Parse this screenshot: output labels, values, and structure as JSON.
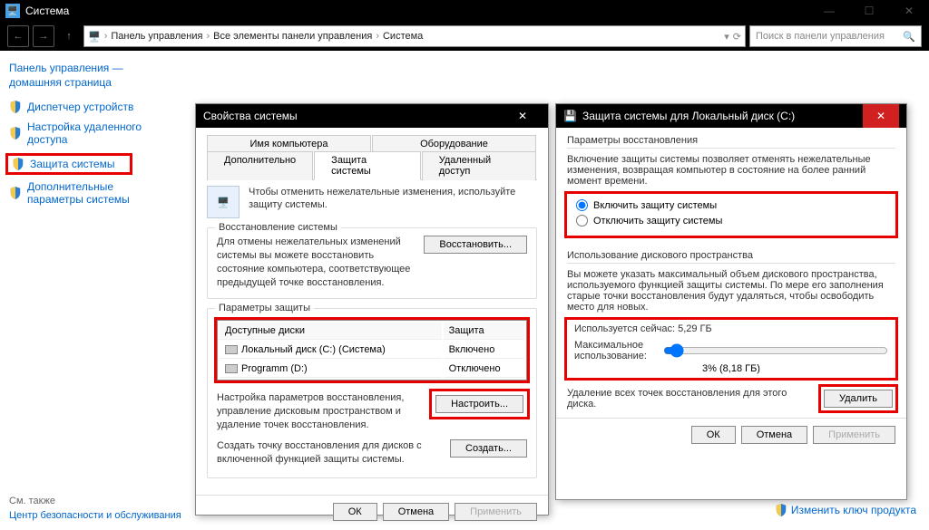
{
  "titlebar": {
    "title": "Система"
  },
  "nav": {
    "breadcrumb": [
      "Панель управления",
      "Все элементы панели управления",
      "Система"
    ],
    "search_placeholder": "Поиск в панели управления"
  },
  "sidebar": {
    "home": "Панель управления — домашняя страница",
    "items": [
      "Диспетчер устройств",
      "Настройка удаленного доступа",
      "Защита системы",
      "Дополнительные параметры системы"
    ],
    "see_also_title": "См. также",
    "see_also_link": "Центр безопасности и обслуживания"
  },
  "sys_props": {
    "title": "Свойства системы",
    "tabs_row1": [
      "Имя компьютера",
      "Оборудование"
    ],
    "tabs_row2": [
      "Дополнительно",
      "Защита системы",
      "Удаленный доступ"
    ],
    "info_text": "Чтобы отменить нежелательные изменения, используйте защиту системы.",
    "restore_group": "Восстановление системы",
    "restore_text": "Для отмены нежелательных изменений системы вы можете восстановить состояние компьютера, соответствующее предыдущей точке восстановления.",
    "restore_btn": "Восстановить...",
    "protection_group": "Параметры защиты",
    "col_disks": "Доступные диски",
    "col_protection": "Защита",
    "disks": [
      {
        "name": "Локальный диск (C:) (Система)",
        "status": "Включено"
      },
      {
        "name": "Programm (D:)",
        "status": "Отключено"
      }
    ],
    "config_text": "Настройка параметров восстановления, управление дисковым пространством и удаление точек восстановления.",
    "config_btn": "Настроить...",
    "create_text": "Создать точку восстановления для дисков с включенной функцией защиты системы.",
    "create_btn": "Создать...",
    "ok": "ОК",
    "cancel": "Отмена",
    "apply": "Применить"
  },
  "prot_dlg": {
    "title": "Защита системы для Локальный диск (C:)",
    "restore_header": "Параметры восстановления",
    "restore_desc": "Включение защиты системы позволяет отменять нежелательные изменения, возвращая компьютер в состояние на более ранний момент времени.",
    "opt_on": "Включить защиту системы",
    "opt_off": "Отключить защиту системы",
    "disk_header": "Использование дискового пространства",
    "disk_desc": "Вы можете указать максимальный объем дискового пространства, используемого функцией защиты системы. По мере его заполнения старые точки восстановления будут удаляться, чтобы освободить место для новых.",
    "current_label": "Используется сейчас:",
    "current_value": "5,29 ГБ",
    "max_label": "Максимальное использование:",
    "slider_below": "3% (8,18 ГБ)",
    "delete_text": "Удаление всех точек восстановления для этого диска.",
    "delete_btn": "Удалить",
    "ok": "ОК",
    "cancel": "Отмена",
    "apply": "Применить"
  },
  "changekey": "Изменить ключ продукта"
}
